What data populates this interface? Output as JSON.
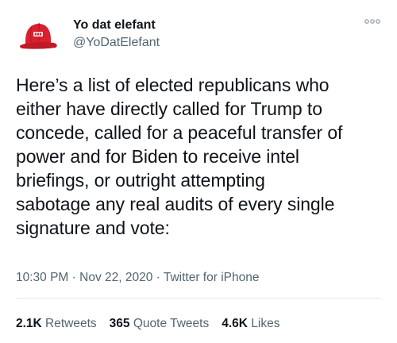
{
  "user": {
    "display_name": "Yo dat elefant",
    "handle": "@YoDatElefant",
    "avatar_icon": "red-hat-avatar-icon"
  },
  "more_icon": "more-dots-icon",
  "tweet": {
    "text": "Here’s a list of elected republicans who\neither have directly called for Trump to\nconcede, called for a peaceful transfer of\npower and for  Biden to receive intel\nbriefings, or outright attempting\nsabotage any real audits of every single\nsignature and vote:"
  },
  "meta": {
    "time": "10:30 PM",
    "sep1": " · ",
    "date": "Nov 22, 2020",
    "sep2": " · ",
    "source": "Twitter for iPhone"
  },
  "stats": {
    "retweets_count": "2.1K",
    "retweets_label": " Retweets",
    "quotes_count": "365",
    "quotes_label": " Quote Tweets",
    "likes_count": "4.6K",
    "likes_label": " Likes"
  },
  "colors": {
    "text": "#0f1419",
    "secondary": "#536471",
    "hat_red": "#d9202e",
    "divider": "#e7e9eb"
  }
}
